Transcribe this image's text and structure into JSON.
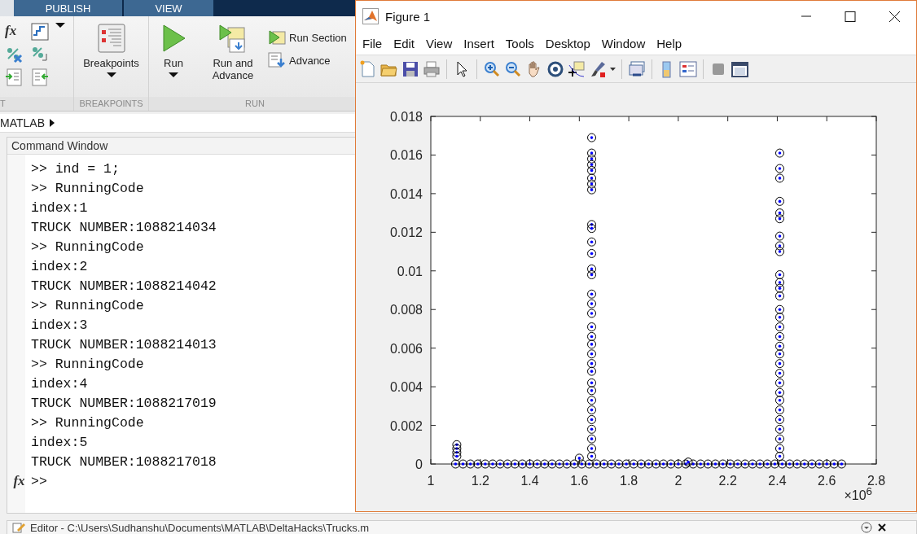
{
  "ribbon": {
    "tabs": [
      {
        "label": "PUBLISH",
        "selected": false
      },
      {
        "label": "VIEW",
        "selected": false
      }
    ],
    "groups": [
      {
        "kind": "edit",
        "label": "T",
        "glyph": "fx"
      },
      {
        "kind": "breakpoints",
        "label": "BREAKPOINTS",
        "buttons": [
          {
            "label": "Breakpoints",
            "kind": "large",
            "dropdown": true
          }
        ]
      },
      {
        "kind": "run",
        "label": "RUN",
        "buttons": [
          {
            "label": "Run",
            "kind": "large",
            "dropdown": true
          },
          {
            "label": "Run and Advance",
            "kind": "large",
            "dropdown": false
          },
          {
            "label": "Run Section",
            "kind": "small"
          },
          {
            "label": "Advance",
            "kind": "small"
          }
        ]
      }
    ]
  },
  "address_bar": {
    "path": "MATLAB"
  },
  "command_window": {
    "title": "Command Window",
    "prompt_glyph": "fx",
    "lines": [
      ">> ind = 1;",
      ">> RunningCode",
      "index:1",
      "TRUCK NUMBER:1088214034",
      ">> RunningCode",
      "index:2",
      "TRUCK NUMBER:1088214042",
      ">> RunningCode",
      "index:3",
      "TRUCK NUMBER:1088214013",
      ">> RunningCode",
      "index:4",
      "TRUCK NUMBER:1088217019",
      ">> RunningCode",
      "index:5",
      "TRUCK NUMBER:1088217018",
      ">>"
    ]
  },
  "figure": {
    "title": "Figure 1",
    "menu": [
      "File",
      "Edit",
      "View",
      "Insert",
      "Tools",
      "Desktop",
      "Window",
      "Help"
    ],
    "chart_data": {
      "type": "scatter",
      "xlim": [
        1,
        2.8
      ],
      "ylim": [
        0,
        0.018
      ],
      "xticks": [
        1,
        1.2,
        1.4,
        1.6,
        1.8,
        2,
        2.2,
        2.4,
        2.6,
        2.8
      ],
      "yticks": [
        0,
        0.002,
        0.004,
        0.006,
        0.008,
        0.01,
        0.012,
        0.014,
        0.016,
        0.018
      ],
      "annotations": [
        "×10$^{6}$"
      ],
      "x": [
        1.1,
        1.13,
        1.16,
        1.19,
        1.22,
        1.25,
        1.28,
        1.31,
        1.34,
        1.37,
        1.4,
        1.43,
        1.46,
        1.49,
        1.52,
        1.55,
        1.58,
        1.61,
        1.64,
        1.67,
        1.7,
        1.73,
        1.76,
        1.79,
        1.82,
        1.85,
        1.88,
        1.91,
        1.94,
        1.97,
        2.0,
        2.03,
        2.06,
        2.09,
        2.12,
        2.15,
        2.18,
        2.21,
        2.24,
        2.27,
        2.3,
        2.33,
        2.36,
        2.39,
        2.42,
        2.45,
        2.48,
        2.51,
        2.54,
        2.57,
        2.6,
        2.63,
        2.66,
        1.105,
        1.105,
        1.105,
        1.105,
        1.6,
        1.65,
        1.65,
        1.65,
        1.65,
        1.65,
        1.65,
        1.65,
        1.65,
        1.65,
        1.65,
        1.65,
        1.65,
        1.65,
        1.65,
        1.65,
        1.65,
        1.65,
        1.65,
        1.65,
        1.65,
        1.65,
        1.65,
        1.65,
        1.65,
        1.65,
        1.65,
        1.65,
        1.65,
        1.65,
        1.65,
        1.65,
        1.65,
        2.04,
        2.41,
        2.41,
        2.41,
        2.41,
        2.41,
        2.41,
        2.41,
        2.41,
        2.41,
        2.41,
        2.41,
        2.41,
        2.41,
        2.41,
        2.41,
        2.41,
        2.41,
        2.41,
        2.41,
        2.41,
        2.41,
        2.41,
        2.41,
        2.41,
        2.41,
        2.41,
        2.41,
        2.41,
        2.41,
        2.41
      ],
      "series": [
        {
          "color": "#000000",
          "values": [
            0,
            0,
            0,
            0,
            0,
            0,
            0,
            0,
            0,
            0,
            0,
            0,
            0,
            0,
            0,
            0,
            0,
            0,
            0,
            0,
            0,
            0,
            0,
            0,
            0,
            0,
            0,
            0,
            0,
            0,
            0,
            0,
            0,
            0,
            0,
            0,
            0,
            0,
            0,
            0,
            0,
            0,
            0,
            0,
            0,
            0,
            0,
            0,
            0,
            0,
            0,
            0,
            0,
            0.001,
            0.0008,
            0.0006,
            0.0004,
            0.0003,
            0.0169,
            0.0161,
            0.0158,
            0.0155,
            0.0152,
            0.0148,
            0.0145,
            0.0142,
            0.0124,
            0.0122,
            0.0115,
            0.0109,
            0.0101,
            0.0098,
            0.0088,
            0.0083,
            0.0078,
            0.0071,
            0.0066,
            0.0062,
            0.0057,
            0.0052,
            0.0048,
            0.0042,
            0.0038,
            0.0033,
            0.0028,
            0.0023,
            0.0018,
            0.0013,
            0.0008,
            0.0004,
            0.0001,
            0.0161,
            0.0153,
            0.0148,
            0.0136,
            0.013,
            0.0127,
            0.0118,
            0.0113,
            0.011,
            0.0098,
            0.0094,
            0.0091,
            0.0087,
            0.008,
            0.0076,
            0.0071,
            0.0066,
            0.0061,
            0.0057,
            0.0052,
            0.0047,
            0.0042,
            0.0037,
            0.0033,
            0.0028,
            0.0023,
            0.0018,
            0.0013,
            0.0008,
            0.0004
          ]
        }
      ]
    }
  },
  "editor_bar": {
    "title": "Editor - C:\\Users\\Sudhanshu\\Documents\\MATLAB\\DeltaHacks\\Trucks.m"
  }
}
